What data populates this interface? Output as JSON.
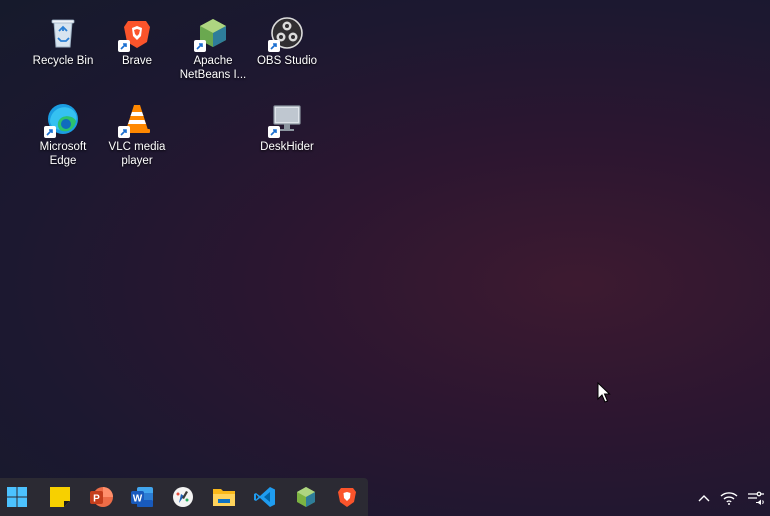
{
  "desktop": {
    "icons": [
      {
        "label": "Recycle Bin"
      },
      {
        "label": "Brave"
      },
      {
        "label": "Apache NetBeans I..."
      },
      {
        "label": "OBS Studio"
      },
      {
        "label": "Microsoft Edge"
      },
      {
        "label": "VLC media player"
      },
      {
        "label": "DeskHider"
      }
    ]
  },
  "taskbar": {
    "pinned": [
      "start-icon",
      "sticky-notes-icon",
      "powerpoint-icon",
      "word-icon",
      "paint-icon",
      "file-explorer-icon",
      "vscode-icon",
      "netbeans-icon",
      "brave-icon"
    ]
  },
  "tray": {
    "icons": [
      "chevron-up-icon",
      "wifi-icon",
      "quick-settings-icon"
    ]
  }
}
